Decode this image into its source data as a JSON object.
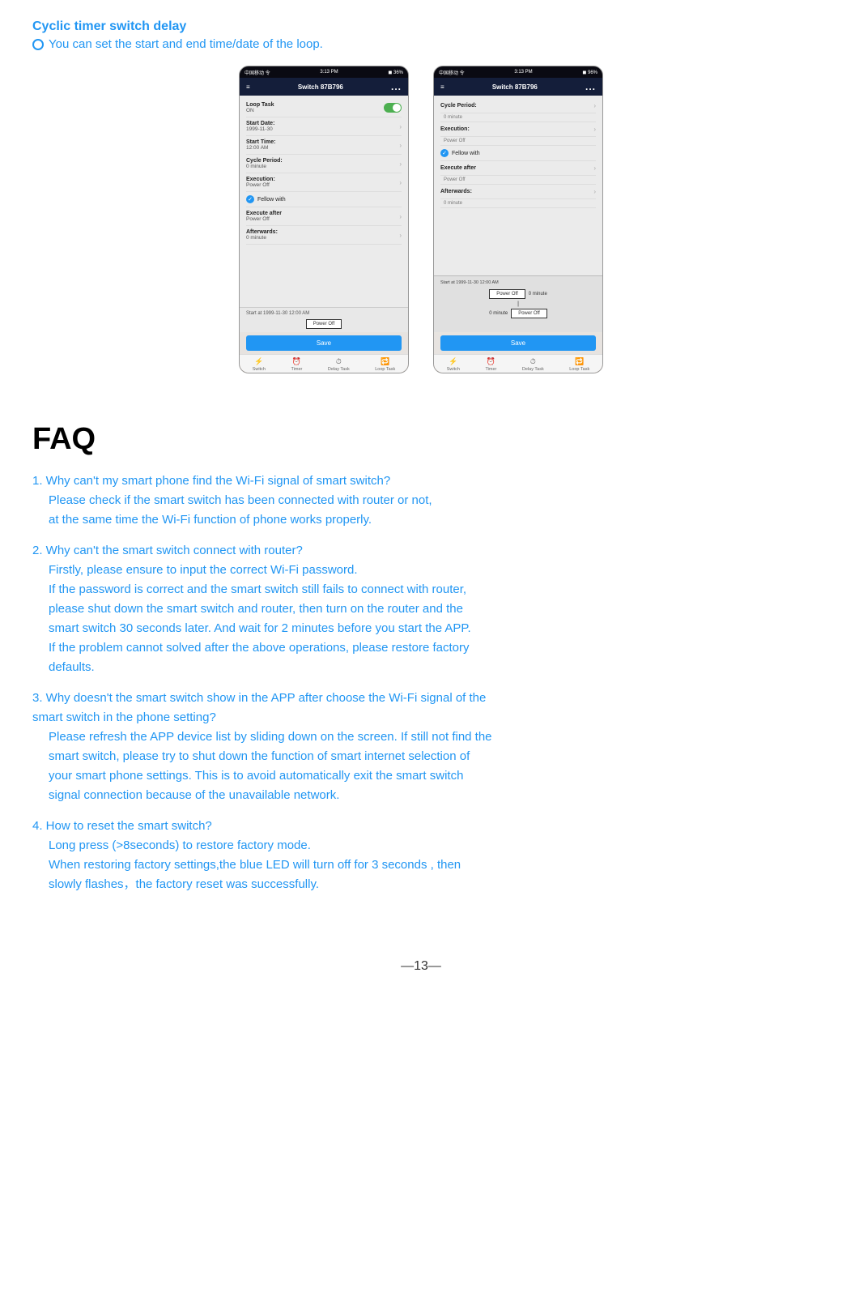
{
  "page": {
    "title": "Cyclic timer switch delay",
    "subtitle": "You can set the start and end time/date of the  loop.",
    "faq_heading": "FAQ",
    "page_number": "—13—"
  },
  "phone_left": {
    "status_bar": {
      "carrier": "中国移动 令",
      "time": "3:13 PM",
      "battery": "◼ 36%"
    },
    "header": {
      "menu_icon": "≡",
      "title": "Switch 87B796",
      "dots": "..."
    },
    "rows": [
      {
        "label": "Loop Task",
        "value": "",
        "type": "toggle"
      },
      {
        "label": "ON",
        "value": "",
        "type": "on-label"
      },
      {
        "label": "Start Date:",
        "value": "1999-11-30",
        "type": "nav"
      },
      {
        "label": "Start Time:",
        "value": "12:00 AM",
        "type": "nav"
      },
      {
        "label": "Cycle Period:",
        "value": "0 minute",
        "type": "nav"
      },
      {
        "label": "Execution:",
        "value": "Power Off",
        "type": "nav"
      },
      {
        "label": "Fellow with",
        "value": "",
        "type": "fellow"
      },
      {
        "label": "Execute after",
        "value": "Power Off",
        "type": "nav"
      },
      {
        "label": "Afterwards:",
        "value": "0 minute",
        "type": "nav"
      }
    ],
    "diagram_start": "Start at 1999-11-30 12:00 AM",
    "save_label": "Save",
    "nav_items": [
      "Switch",
      "Timer",
      "Delay Task",
      "Loop Task"
    ]
  },
  "phone_right": {
    "status_bar": {
      "carrier": "中国移动 令",
      "time": "3:13 PM",
      "battery": "◼ 96%"
    },
    "header": {
      "menu_icon": "≡",
      "title": "Switch 87B796",
      "dots": "..."
    },
    "rows": [
      {
        "label": "Cycle Period:",
        "value": "",
        "type": "nav"
      },
      {
        "label": "0 minute",
        "value": "",
        "type": "sub"
      },
      {
        "label": "Execution:",
        "value": "",
        "type": "nav"
      },
      {
        "label": "Power Off",
        "value": "",
        "type": "sub"
      },
      {
        "label": "Fellow with",
        "value": "",
        "type": "fellow"
      },
      {
        "label": "Execute after",
        "value": "",
        "type": "nav"
      },
      {
        "label": "Power Off",
        "value": "",
        "type": "sub"
      },
      {
        "label": "Afterwards:",
        "value": "",
        "type": "nav"
      },
      {
        "label": "0 minute",
        "value": "",
        "type": "sub"
      }
    ],
    "diagram": {
      "start": "Start at 1999-11-30 12:00 AM",
      "box1": "Power Off",
      "label1": "0 minute",
      "box2": "Power Off",
      "label2": "0 minute"
    },
    "save_label": "Save",
    "nav_items": [
      "Switch",
      "Timer",
      "Delay Task",
      "Loop Task"
    ]
  },
  "faq": {
    "heading": "FAQ",
    "items": [
      {
        "number": "1.",
        "question": "Why can't my smart phone find the Wi-Fi signal of smart switch?",
        "answer": "Please check  if the smart switch has been connected with router or not,\n at the same time the Wi-Fi function of phone works properly."
      },
      {
        "number": "2.",
        "question": "Why can't the smart switch connect with router?",
        "answer": "Firstly, please ensure  to input the correct Wi-Fi password.\n If the password is correct and the smart switch still fails to connect with router,\nplease shut down the smart switch and router, then turn on the router  and the\nsmart switch 30 seconds later. And wait for 2 minutes before you start the APP.\nIf the problem cannot solved after the above operations, please restore  factory\ndefaults."
      },
      {
        "number": "3.",
        "question": "Why doesn't the smart switch show in the APP after choose the Wi-Fi signal of the\n     smart switch in the phone setting?",
        "answer": "Please refresh the APP device list by sliding down on the screen. If still not find the\nsmart switch, please try to shut down the function of smart internet selection of\nyour smart phone settings. This is to avoid automatically exit the smart switch\n signal connection because of the unavailable network."
      },
      {
        "number": "4.",
        "question": "How to reset the smart switch?",
        "answer": "Long press (>8seconds) to restore factory mode.\nWhen restoring factory settings,the blue LED will turn off for 3 seconds , then\nslowly flashes，the factory reset was successfully."
      }
    ],
    "page_number": "—13—"
  }
}
